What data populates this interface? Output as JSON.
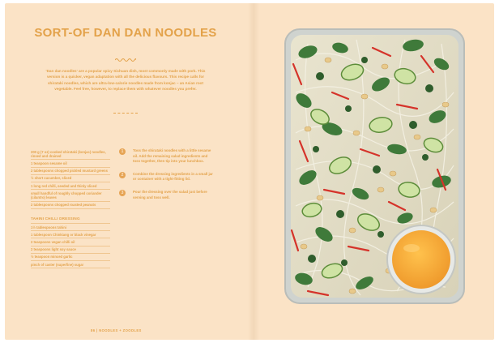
{
  "recipe": {
    "title": "SORT-OF DAN DAN NOODLES",
    "intro": "'Dan dan noodles' are a popular spicy Sichuan dish, most commonly made with pork. This version is a quicker, vegan adaptation with all the delicious flavours. This recipe calls for shirataki noodles, which are ultra-low-calorie noodles made from konjac – an Asian root vegetable. Feel free, however, to replace them with whatever noodles you prefer."
  },
  "ingredients": [
    "200 g (7 oz) cooked shirataki (konjac) noodles, rinsed and drained",
    "1 teaspoon sesame oil",
    "2 tablespoons chopped pickled mustard greens",
    "½ short cucumber, sliced",
    "1 long red chilli, seeded and thinly sliced",
    "small handful of roughly chopped coriander (cilantro) leaves",
    "2 tablespoons chopped roasted peanuts"
  ],
  "dressing": {
    "heading": "TAHINI CHILLI DRESSING",
    "items": [
      "1½ tablespoons tahini",
      "1 tablespoon Chinkiang or black vinegar",
      "2 teaspoons vegan chilli oil",
      "2 teaspoons light soy sauce",
      "½ teaspoon minced garlic",
      "pinch of caster (superfine) sugar"
    ]
  },
  "steps": [
    {
      "num": "1",
      "text": "Toss the shirataki noodles with a little sesame oil. Add the remaining salad ingredients and toss together, then tip into your lunchbox."
    },
    {
      "num": "2",
      "text": "Combine the dressing ingredients in a small jar or container with a tight-fitting lid."
    },
    {
      "num": "3",
      "text": "Pour the dressing over the salad just before serving and toss well."
    }
  ],
  "footer": {
    "page_number": "86",
    "section": "NOODLES + ZOODLES"
  },
  "colors": {
    "page": "#fbe3c6",
    "accent": "#e3a24a",
    "dressing": "#f4a93d"
  }
}
